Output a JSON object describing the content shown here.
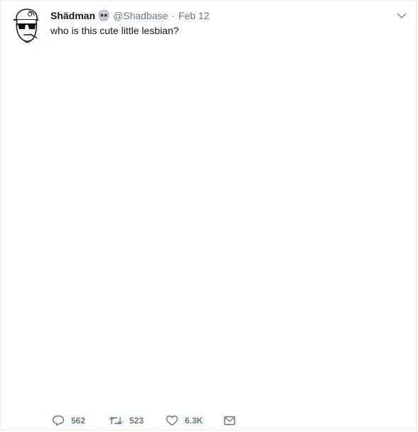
{
  "tweet": {
    "author": {
      "display_name": "Shädman",
      "badge_icon": "skull-icon",
      "handle": "@Shadbase",
      "avatar_icon": "cartoon-face-avatar"
    },
    "separator": "·",
    "date": "Feb 12",
    "text": "who is this cute little lesbian?",
    "menu_icon": "chevron-down-icon"
  },
  "actions": {
    "reply": {
      "icon": "reply-icon",
      "count": "562"
    },
    "retweet": {
      "icon": "retweet-icon",
      "count": "523"
    },
    "like": {
      "icon": "heart-icon",
      "count": "6.3K"
    },
    "message": {
      "icon": "envelope-icon"
    }
  },
  "colors": {
    "text_primary": "#14171a",
    "text_secondary": "#657786",
    "border": "#e6ecf0"
  }
}
